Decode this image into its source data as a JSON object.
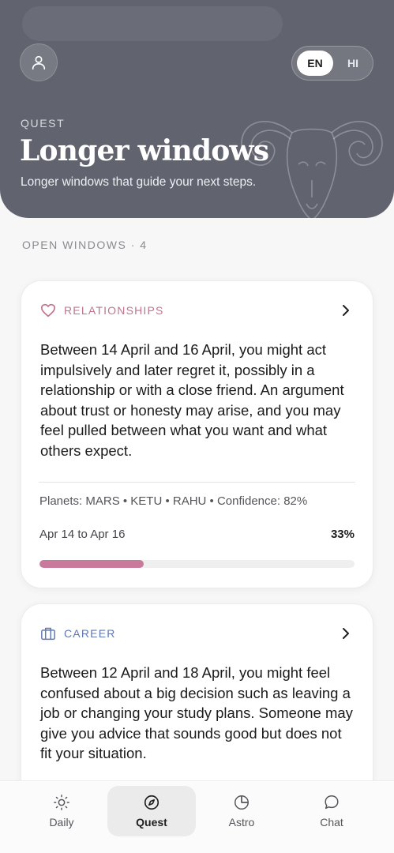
{
  "header": {
    "kicker": "QUEST",
    "title": "Longer windows",
    "subtitle": "Longer windows that guide your next steps.",
    "lang": {
      "active": "EN",
      "inactive": "HI"
    }
  },
  "section": {
    "label": "OPEN WINDOWS · 4"
  },
  "cards": [
    {
      "category": "RELATIONSHIPS",
      "category_color": "#c0738e",
      "icon": "heart-icon",
      "body": "Between 14 April and 16 April, you might act impulsively and later regret it, possibly in a relationship or with a close friend. An argument about trust or honesty may arise, and you may feel pulled between what you want and what others expect.",
      "meta": "Planets: MARS • KETU • RAHU • Confidence: 82%",
      "range": "Apr 14 to Apr 16",
      "progress_label": "33%",
      "progress": 0.33,
      "bar_color": "#c97a9c"
    },
    {
      "category": "CAREER",
      "category_color": "#6078b4",
      "icon": "briefcase-icon",
      "body": "Between 12 April and 18 April, you might feel confused about a big decision such as leaving a job or changing your study plans. Someone may give you advice that sounds good but does not fit your situation."
    }
  ],
  "nav": {
    "items": [
      {
        "label": "Daily",
        "icon": "sun-icon"
      },
      {
        "label": "Quest",
        "icon": "compass-icon"
      },
      {
        "label": "Astro",
        "icon": "pie-chart-icon"
      },
      {
        "label": "Chat",
        "icon": "chat-bubble-icon"
      }
    ],
    "active": "Quest"
  }
}
